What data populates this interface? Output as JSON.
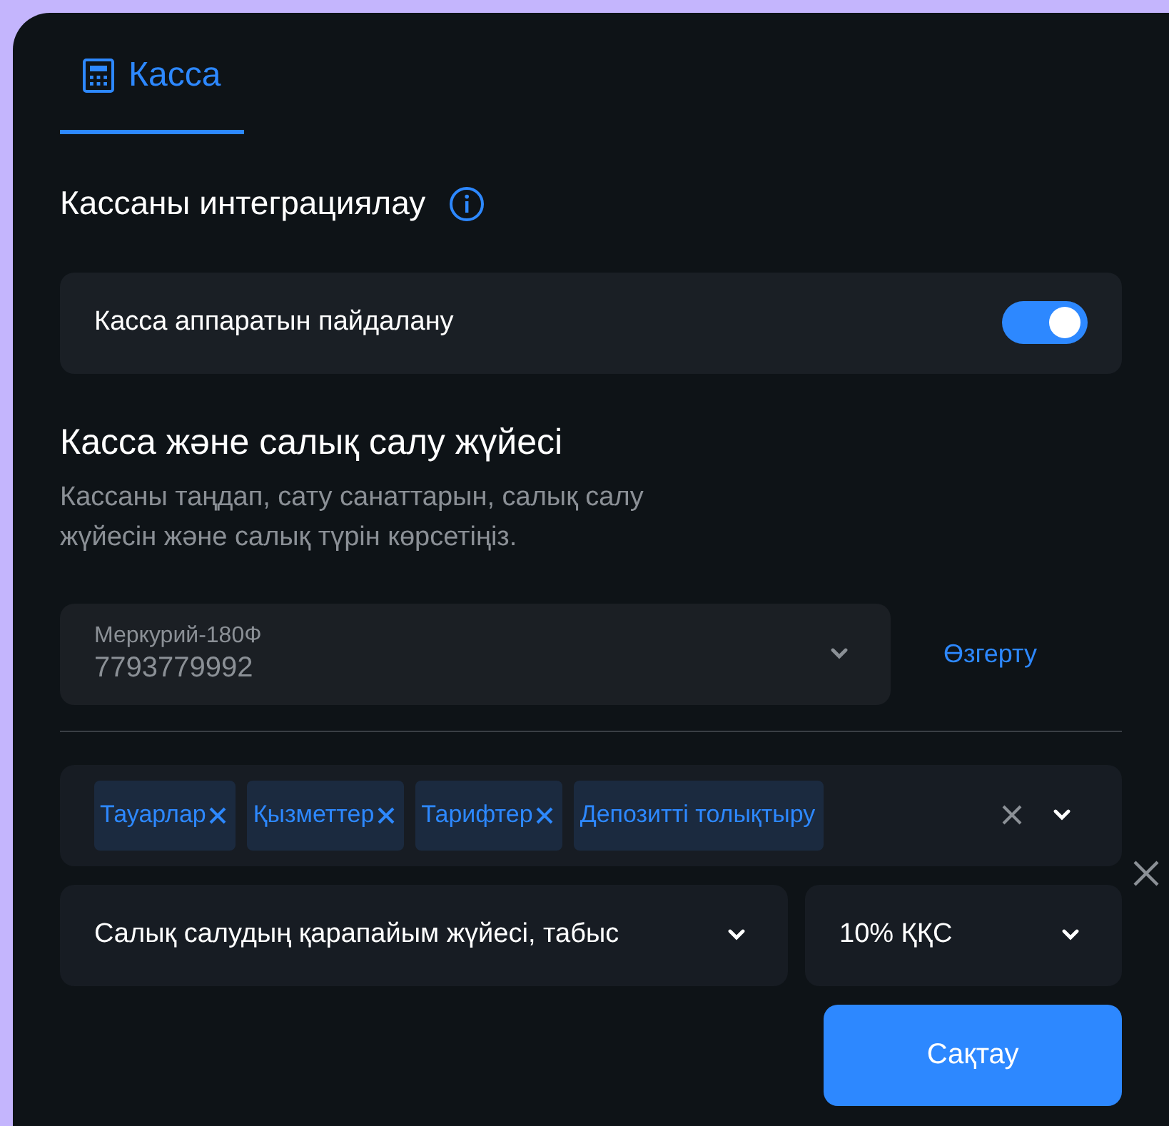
{
  "tabs": [
    {
      "label": "Касса",
      "selected": true
    }
  ],
  "integration": {
    "title": "Кассаны интеграциялау"
  },
  "toggle_row": {
    "label": "Касса аппаратын пайдалану",
    "on": true
  },
  "section": {
    "title": "Касса және салық салу жүйесі",
    "description": "Кассаны таңдап, сату санаттарын, салық салу жүйесін және салық түрін көрсетіңіз."
  },
  "cash_register": {
    "label": "Меркурий-180Ф",
    "value": "7793779992",
    "change_link": "Өзгерту"
  },
  "categories": {
    "tags": [
      {
        "label": "Тауарлар",
        "removable": true
      },
      {
        "label": "Қызметтер",
        "removable": true
      },
      {
        "label": "Тарифтер",
        "removable": true
      },
      {
        "label": "Депозитті толықтыру",
        "removable": false
      }
    ]
  },
  "tax_system": {
    "value": "Салық салудың қарапайым жүйесі, табыс"
  },
  "vat": {
    "value": "10% ҚҚС"
  },
  "save_button": "Сақтау"
}
